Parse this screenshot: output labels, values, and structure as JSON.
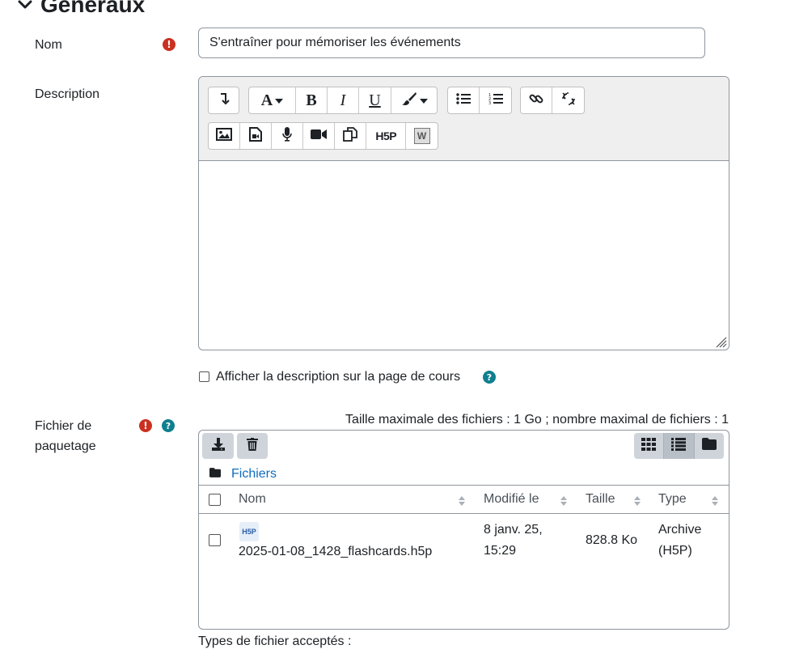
{
  "section": {
    "title": "Généraux"
  },
  "fields": {
    "name": {
      "label": "Nom",
      "value": "S'entraîner pour mémoriser les événements"
    },
    "description": {
      "label": "Description",
      "show_on_course_label": "Afficher la description sur la page de cours"
    },
    "package": {
      "label_line1": "Fichier de",
      "label_line2": "paquetage",
      "limits": "Taille maximale des fichiers : 1 Go ; nombre maximal de fichiers : 1",
      "breadcrumb": "Fichiers",
      "columns": {
        "name": "Nom",
        "modified": "Modifié le",
        "size": "Taille",
        "type": "Type"
      },
      "files": [
        {
          "name": "2025-01-08_1428_flashcards.h5p",
          "modified_line1": "8 janv. 25,",
          "modified_line2": "15:29",
          "size": "828.8 Ko",
          "type_line1": "Archive",
          "type_line2": "(H5P)",
          "thumb_text": "H5P"
        }
      ],
      "accepted_types": "Types de fichier acceptés :"
    }
  },
  "toolbar": {
    "font_letter": "A",
    "bold_letter": "B",
    "italic_letter": "I",
    "underline_letter": "U",
    "h5p_label": "H5P",
    "word_label": "W"
  },
  "colors": {
    "required": "#ca3120",
    "help": "#0f7f8f",
    "link": "#0f6cbf",
    "border": "#8f959e"
  }
}
